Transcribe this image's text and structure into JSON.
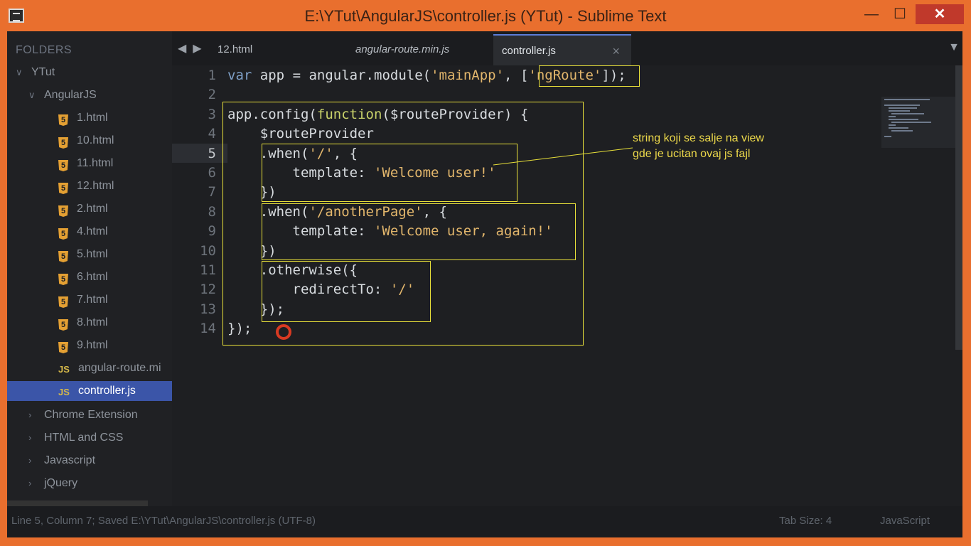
{
  "window": {
    "title": "E:\\YTut\\AngularJS\\controller.js (YTut) - Sublime Text",
    "minimize": "—",
    "maximize": "☐",
    "close": "✕"
  },
  "sidebar": {
    "header": "FOLDERS",
    "root": "YTut",
    "folder": "AngularJS",
    "files": [
      {
        "label": "1.html",
        "type": "html"
      },
      {
        "label": "10.html",
        "type": "html"
      },
      {
        "label": "11.html",
        "type": "html"
      },
      {
        "label": "12.html",
        "type": "html"
      },
      {
        "label": "2.html",
        "type": "html"
      },
      {
        "label": "4.html",
        "type": "html"
      },
      {
        "label": "5.html",
        "type": "html"
      },
      {
        "label": "6.html",
        "type": "html"
      },
      {
        "label": "7.html",
        "type": "html"
      },
      {
        "label": "8.html",
        "type": "html"
      },
      {
        "label": "9.html",
        "type": "html"
      },
      {
        "label": "angular-route.mi",
        "type": "js"
      },
      {
        "label": "controller.js",
        "type": "js",
        "active": true
      }
    ],
    "folders": [
      "Chrome Extension",
      "HTML and CSS",
      "Javascript",
      "jQuery"
    ],
    "html_icon_glyph": "5",
    "js_icon_glyph": "JS"
  },
  "tabs": [
    {
      "label": "12.html"
    },
    {
      "label": "angular-route.min.js"
    },
    {
      "label": "controller.js",
      "active": true
    }
  ],
  "tab_close": "×",
  "tab_nav_left": "◀",
  "tab_nav_right": "▶",
  "tab_dropdown": "▼",
  "editor": {
    "current_line": 5,
    "lines": [
      "var app = angular.module('mainApp', ['ngRoute']);",
      "",
      "app.config(function($routeProvider) {",
      "    $routeProvider",
      "    .when('/', {",
      "        template: 'Welcome user!'",
      "    })",
      "    .when('/anotherPage', {",
      "        template: 'Welcome user, again!'",
      "    })",
      "    .otherwise({",
      "        redirectTo: '/'",
      "    });",
      "});"
    ]
  },
  "annotation": "string koji se salje na view\ngde je ucitan ovaj js fajl",
  "status": {
    "left": "Line 5, Column 7; Saved E:\\YTut\\AngularJS\\controller.js (UTF-8)",
    "tab_size": "Tab Size: 4",
    "syntax": "JavaScript"
  },
  "colors": {
    "frame": "#e96f2e",
    "highlight_box": "#e8e03a",
    "annotation": "#ecd84a",
    "active_file": "#3b55a8"
  }
}
